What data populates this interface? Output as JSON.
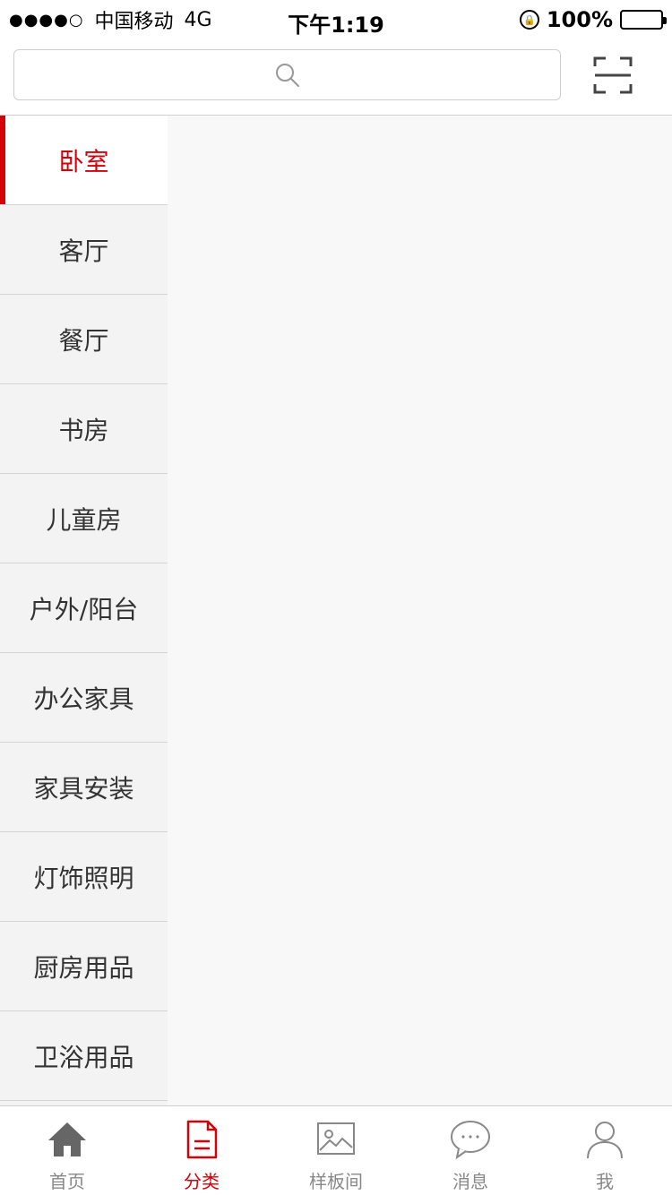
{
  "status_bar": {
    "signal": "●●●●○",
    "carrier": "中国移动",
    "network": "4G",
    "time": "下午1:19",
    "battery": "100%"
  },
  "search": {
    "placeholder": ""
  },
  "sidebar": {
    "items": [
      {
        "label": "卧室",
        "active": true
      },
      {
        "label": "客厅"
      },
      {
        "label": "餐厅"
      },
      {
        "label": "书房"
      },
      {
        "label": "儿童房"
      },
      {
        "label": "户外/阳台"
      },
      {
        "label": "办公家具"
      },
      {
        "label": "家具安装"
      },
      {
        "label": "灯饰照明"
      },
      {
        "label": "厨房用品"
      },
      {
        "label": "卫浴用品"
      }
    ]
  },
  "tabbar": {
    "items": [
      {
        "label": "首页",
        "icon": "home-icon"
      },
      {
        "label": "分类",
        "icon": "document-icon",
        "active": true
      },
      {
        "label": "样板间",
        "icon": "image-icon"
      },
      {
        "label": "消息",
        "icon": "chat-icon"
      },
      {
        "label": "我",
        "icon": "user-icon"
      }
    ]
  },
  "colors": {
    "accent": "#d4000a",
    "tab_inactive": "#888888",
    "sidebar_bg": "#f3f3f3",
    "content_bg": "#f8f8f8"
  }
}
